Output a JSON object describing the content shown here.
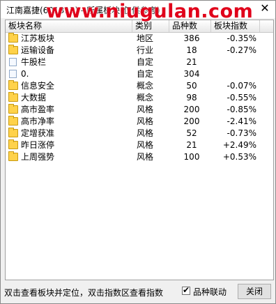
{
  "window": {
    "title": "江南嘉捷(601313) - 所属板块(仅供参考)",
    "close_glyph": "✕"
  },
  "watermark": "www.niugulan.com",
  "table": {
    "headers": [
      "板块名称",
      "类别",
      "品种数",
      "板块指数"
    ],
    "rows": [
      {
        "icon": "folder-icon",
        "name": "江苏板块",
        "type": "地区",
        "count": "386",
        "index": "-0.35%"
      },
      {
        "icon": "folder-icon",
        "name": "运输设备",
        "type": "行业",
        "count": "18",
        "index": "-0.27%"
      },
      {
        "icon": "document-icon",
        "name": "牛股栏",
        "type": "自定",
        "count": "21",
        "index": ""
      },
      {
        "icon": "document-icon",
        "name": "0.",
        "type": "自定",
        "count": "304",
        "index": ""
      },
      {
        "icon": "folder-icon",
        "name": "信息安全",
        "type": "概念",
        "count": "50",
        "index": "-0.07%"
      },
      {
        "icon": "folder-icon",
        "name": "大数据",
        "type": "概念",
        "count": "98",
        "index": "-0.55%"
      },
      {
        "icon": "folder-icon",
        "name": "高市盈率",
        "type": "风格",
        "count": "200",
        "index": "-0.85%"
      },
      {
        "icon": "folder-icon",
        "name": "高市净率",
        "type": "风格",
        "count": "200",
        "index": "-2.41%"
      },
      {
        "icon": "folder-icon",
        "name": "定增获准",
        "type": "风格",
        "count": "52",
        "index": "-0.73%"
      },
      {
        "icon": "folder-icon",
        "name": "昨日涨停",
        "type": "风格",
        "count": "21",
        "index": "+2.49%"
      },
      {
        "icon": "folder-icon",
        "name": "上周强势",
        "type": "风格",
        "count": "100",
        "index": "+0.53%"
      }
    ]
  },
  "footer": {
    "hint": "双击查看板块并定位，双击指数区查看指数",
    "checkbox_label": "品种联动",
    "checkbox_checked": true,
    "check_glyph": "✔",
    "close_button": "关闭"
  }
}
